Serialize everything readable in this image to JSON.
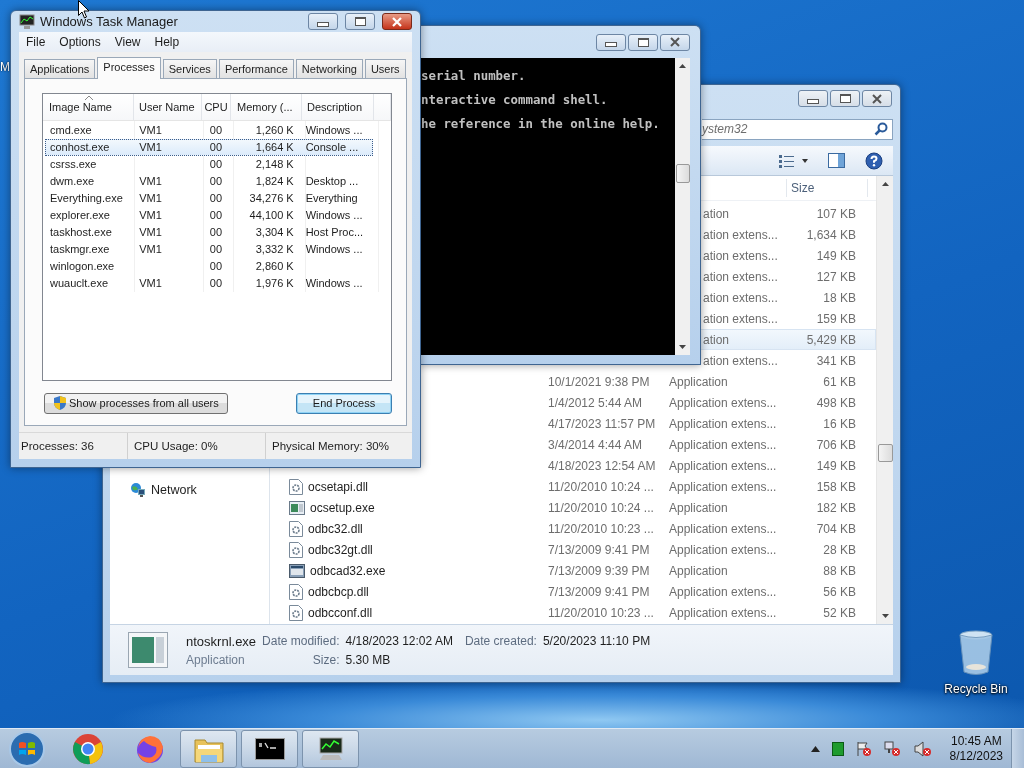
{
  "desktop": {
    "icon_fragment": "M",
    "recycle_bin": "Recycle Bin"
  },
  "task_manager": {
    "title": "Windows Task Manager",
    "menu": [
      "File",
      "Options",
      "View",
      "Help"
    ],
    "tabs": [
      {
        "label": "Applications",
        "selected": false
      },
      {
        "label": "Processes",
        "selected": true
      },
      {
        "label": "Services",
        "selected": false
      },
      {
        "label": "Performance",
        "selected": false
      },
      {
        "label": "Networking",
        "selected": false
      },
      {
        "label": "Users",
        "selected": false
      }
    ],
    "columns": [
      "Image Name",
      "User Name",
      "CPU",
      "Memory (...",
      "Description"
    ],
    "rows": [
      {
        "image": "cmd.exe",
        "user": "VM1",
        "cpu": "00",
        "memory": "1,260 K",
        "description": "Windows ...",
        "selected": false
      },
      {
        "image": "conhost.exe",
        "user": "VM1",
        "cpu": "00",
        "memory": "1,664 K",
        "description": "Console ...",
        "selected": true
      },
      {
        "image": "csrss.exe",
        "cpu": "00",
        "memory": "2,148 K",
        "selected": false
      },
      {
        "image": "dwm.exe",
        "user": "VM1",
        "cpu": "00",
        "memory": "1,824 K",
        "description": "Desktop ...",
        "selected": false
      },
      {
        "image": "Everything.exe",
        "user": "VM1",
        "cpu": "00",
        "memory": "34,276 K",
        "description": "Everything",
        "selected": false
      },
      {
        "image": "explorer.exe",
        "user": "VM1",
        "cpu": "00",
        "memory": "44,100 K",
        "description": "Windows ...",
        "selected": false
      },
      {
        "image": "taskhost.exe",
        "user": "VM1",
        "cpu": "00",
        "memory": "3,304 K",
        "description": "Host Proc...",
        "selected": false
      },
      {
        "image": "taskmgr.exe",
        "user": "VM1",
        "cpu": "00",
        "memory": "3,332 K",
        "description": "Windows ...",
        "selected": false
      },
      {
        "image": "winlogon.exe",
        "cpu": "00",
        "memory": "2,860 K",
        "selected": false
      },
      {
        "image": "wuauclt.exe",
        "user": "VM1",
        "cpu": "00",
        "memory": "1,976 K",
        "description": "Windows ...",
        "selected": false
      }
    ],
    "show_all_button": "Show processes from all users",
    "end_button": "End Process",
    "status": [
      "Processes: 36",
      "CPU Usage: 0%",
      "Physical Memory: 30%"
    ]
  },
  "console": {
    "lines": [
      "serial number.",
      "nteractive command shell.",
      "he reference in the online help."
    ]
  },
  "explorer": {
    "search": "ystem32",
    "size_header": "Size",
    "nav": [
      "Network"
    ],
    "rows_behind_console": [
      {
        "type": "ation",
        "size": "107 KB",
        "hovered": false
      },
      {
        "type": "ation extens...",
        "size": "1,634 KB",
        "hovered": false
      },
      {
        "type": "ation extens...",
        "size": "149 KB",
        "hovered": false
      },
      {
        "type": "ation extens...",
        "size": "127 KB",
        "hovered": false
      },
      {
        "type": "ation extens...",
        "size": "18 KB",
        "hovered": false
      },
      {
        "type": "ation extens...",
        "size": "159 KB",
        "hovered": false
      },
      {
        "type": "ation",
        "size": "5,429 KB",
        "hovered": true
      },
      {
        "type": "ation extens...",
        "size": "341 KB",
        "hovered": false
      }
    ],
    "rows": [
      {
        "date": "10/1/2021 9:38 PM",
        "type": "Application",
        "size": "61 KB"
      },
      {
        "date": "1/4/2012 5:44 AM",
        "type": "Application extens...",
        "size": "498 KB"
      },
      {
        "date": "4/17/2023 11:57 PM",
        "type": "Application extens...",
        "size": "16 KB"
      },
      {
        "date": "3/4/2014 4:44 AM",
        "type": "Application extens...",
        "size": "706 KB"
      },
      {
        "date": "4/18/2023 12:54 AM",
        "type": "Application extens...",
        "size": "149 KB"
      },
      {
        "name": "ocsetapi.dll",
        "kind": "dll",
        "date": "11/20/2010 10:24 ...",
        "type": "Application extens...",
        "size": "158 KB"
      },
      {
        "name": "ocsetup.exe",
        "kind": "exe",
        "date": "11/20/2010 10:24 ...",
        "type": "Application",
        "size": "182 KB"
      },
      {
        "name": "odbc32.dll",
        "kind": "dll",
        "date": "11/20/2010 10:23 ...",
        "type": "Application extens...",
        "size": "704 KB"
      },
      {
        "name": "odbc32gt.dll",
        "kind": "dll",
        "date": "7/13/2009 9:41 PM",
        "type": "Application extens...",
        "size": "28 KB"
      },
      {
        "name": "odbcad32.exe",
        "kind": "tool",
        "date": "7/13/2009 9:39 PM",
        "type": "Application",
        "size": "88 KB"
      },
      {
        "name": "odbcbcp.dll",
        "kind": "dll",
        "date": "7/13/2009 9:41 PM",
        "type": "Application extens...",
        "size": "56 KB"
      },
      {
        "name": "odbcconf.dll",
        "kind": "dll",
        "date": "11/20/2010 10:23 ...",
        "type": "Application extens...",
        "size": "52 KB"
      }
    ],
    "details": {
      "name": "ntoskrnl.exe",
      "modified_label": "Date modified:",
      "modified": "4/18/2023 12:02 AM",
      "created_label": "Date created:",
      "created": "5/20/2023 11:10 PM",
      "type": "Application",
      "size_label": "Size:",
      "size": "5.30 MB"
    }
  },
  "taskbar": {
    "time": "10:45 AM",
    "date": "8/12/2023"
  }
}
